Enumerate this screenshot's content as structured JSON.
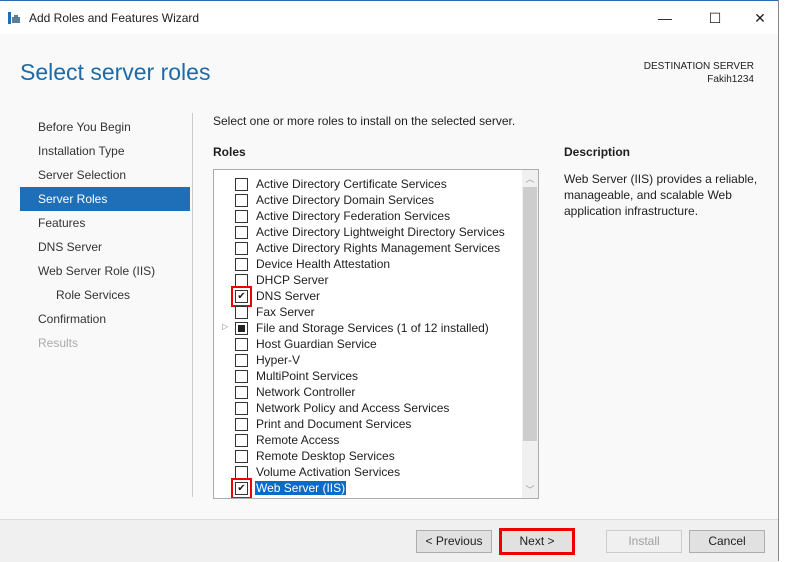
{
  "window": {
    "title": "Add Roles and Features Wizard",
    "minimize": "—",
    "maximize": "☐",
    "close": "✕"
  },
  "header": {
    "title": "Select server roles",
    "dest_label": "DESTINATION SERVER",
    "dest_name": "Fakih1234"
  },
  "nav": {
    "items": [
      {
        "label": "Before You Begin"
      },
      {
        "label": "Installation Type"
      },
      {
        "label": "Server Selection"
      },
      {
        "label": "Server Roles",
        "selected": true
      },
      {
        "label": "Features"
      },
      {
        "label": "DNS Server"
      },
      {
        "label": "Web Server Role (IIS)"
      },
      {
        "label": "Role Services",
        "sub": true
      },
      {
        "label": "Confirmation"
      },
      {
        "label": "Results",
        "disabled": true
      }
    ]
  },
  "main": {
    "intro": "Select one or more roles to install on the selected server.",
    "roles_header": "Roles",
    "description_header": "Description",
    "description": "Web Server (IIS) provides a reliable, manageable, and scalable Web application infrastructure.",
    "roles": [
      {
        "label": "Active Directory Certificate Services",
        "state": "unchecked"
      },
      {
        "label": "Active Directory Domain Services",
        "state": "unchecked"
      },
      {
        "label": "Active Directory Federation Services",
        "state": "unchecked"
      },
      {
        "label": "Active Directory Lightweight Directory Services",
        "state": "unchecked"
      },
      {
        "label": "Active Directory Rights Management Services",
        "state": "unchecked"
      },
      {
        "label": "Device Health Attestation",
        "state": "unchecked"
      },
      {
        "label": "DHCP Server",
        "state": "unchecked"
      },
      {
        "label": "DNS Server",
        "state": "checked",
        "highlight": true
      },
      {
        "label": "Fax Server",
        "state": "unchecked"
      },
      {
        "label": "File and Storage Services (1 of 12 installed)",
        "state": "partial",
        "expandable": true
      },
      {
        "label": "Host Guardian Service",
        "state": "unchecked"
      },
      {
        "label": "Hyper-V",
        "state": "unchecked"
      },
      {
        "label": "MultiPoint Services",
        "state": "unchecked"
      },
      {
        "label": "Network Controller",
        "state": "unchecked"
      },
      {
        "label": "Network Policy and Access Services",
        "state": "unchecked"
      },
      {
        "label": "Print and Document Services",
        "state": "unchecked"
      },
      {
        "label": "Remote Access",
        "state": "unchecked"
      },
      {
        "label": "Remote Desktop Services",
        "state": "unchecked"
      },
      {
        "label": "Volume Activation Services",
        "state": "unchecked"
      },
      {
        "label": "Web Server (IIS)",
        "state": "checked",
        "highlight": true,
        "selected": true
      }
    ]
  },
  "footer": {
    "previous": "< Previous",
    "next": "Next >",
    "install": "Install",
    "cancel": "Cancel"
  }
}
